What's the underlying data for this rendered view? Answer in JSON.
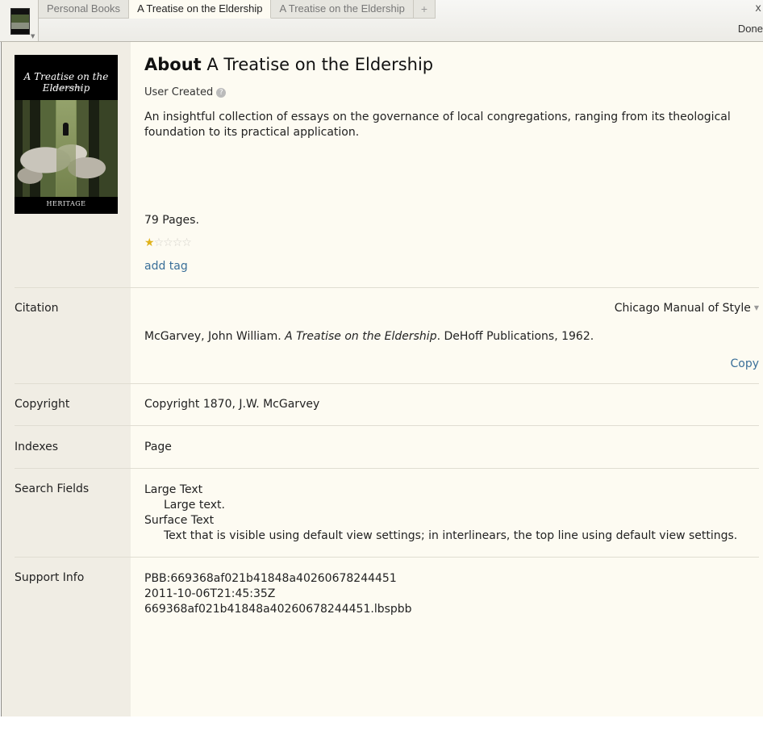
{
  "tabs": [
    {
      "label": "Personal Books"
    },
    {
      "label": "A Treatise on the Eldership"
    },
    {
      "label": "A Treatise on the Eldership"
    },
    {
      "label": "+"
    }
  ],
  "window": {
    "close_glyph": "x",
    "done_label": "Done"
  },
  "cover": {
    "title": "A Treatise on the Eldership",
    "author": "J. W. McGarvey",
    "publisher_logo": "HERITAGE"
  },
  "about": {
    "heading_bold": "About",
    "heading_title": "A Treatise on the Eldership",
    "user_created": "User Created",
    "help_glyph": "?",
    "description": "An insightful collection of essays on the governance of local congregations, ranging from its theological foundation to its practical application.",
    "pages": "79 Pages.",
    "rating": {
      "value": 1,
      "max": 5
    },
    "add_tag": "add tag"
  },
  "citation": {
    "label": "Citation",
    "style": "Chicago Manual of Style",
    "text_before": "McGarvey, John William. ",
    "text_title": "A Treatise on the Eldership",
    "text_after": ". DeHoff Publications, 1962.",
    "copy": "Copy"
  },
  "copyright": {
    "label": "Copyright",
    "value": "Copyright 1870, J.W. McGarvey"
  },
  "indexes": {
    "label": "Indexes",
    "value": "Page"
  },
  "search_fields": {
    "label": "Search Fields",
    "items": [
      {
        "name": "Large Text",
        "desc": "Large text."
      },
      {
        "name": "Surface Text",
        "desc": "Text that is visible using default view settings; in interlinears, the top line using default view settings."
      }
    ]
  },
  "support": {
    "label": "Support Info",
    "lines": [
      "PBB:669368af021b41848a40260678244451",
      "2011-10-06T21:45:35Z",
      "669368af021b41848a40260678244451.lbspbb"
    ]
  },
  "colors": {
    "link": "#3a6f99",
    "star_on": "#e0b21a",
    "panel_bg": "#fdfbf2",
    "left_bg": "#f0ede4"
  }
}
